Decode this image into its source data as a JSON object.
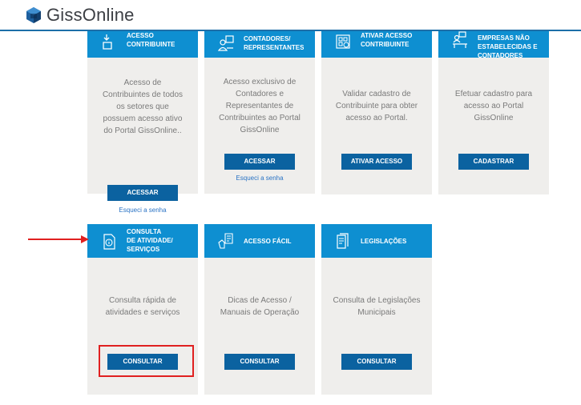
{
  "app": {
    "logo_text": "GissOnline"
  },
  "colors": {
    "header_blue": "#0e8fd1",
    "button_blue": "#0b62a0",
    "card_bg": "#efeeec",
    "annotation_red": "#e02020"
  },
  "cards": [
    {
      "title": "Acesso\nContribuinte",
      "icon": "door-enter-icon",
      "description": "Acesso de\nContribuintes de todos\nos setores que\npossuem acesso ativo\ndo Portal GissOnline..",
      "button": "ACESSAR",
      "link": "Esqueci a senha"
    },
    {
      "title": "Contadores/\nRepresentantes",
      "icon": "accountant-icon",
      "description": "Acesso exclusivo de\nContadores e\nRepresentantes de\nContribuintes ao Portal\nGissOnline",
      "button": "ACESSAR",
      "link": "Esqueci a senha"
    },
    {
      "title": "Ativar Acesso\nContribuinte",
      "icon": "qr-activate-icon",
      "description": "Validar cadastro de\nContribuinte para obter\nacesso ao Portal.",
      "button": "ATIVAR ACESSO"
    },
    {
      "title": "Empresas não\nestabelecidas e\ncontadores",
      "icon": "company-desk-icon",
      "description": "Efetuar cadastro para\nacesso ao Portal\nGissOnline",
      "button": "CADASTRAR"
    },
    {
      "title": "Consulta\nde atividade/\nserviços",
      "icon": "document-info-icon",
      "description": "Consulta rápida de\natividades e serviços",
      "button": "CONSULTAR"
    },
    {
      "title": "Acesso Fácil",
      "icon": "hand-document-icon",
      "description": "Dicas de Acesso /\nManuais de Operação",
      "button": "CONSULTAR"
    },
    {
      "title": "Legislações",
      "icon": "legislation-book-icon",
      "description": "Consulta de Legislações\nMunicipais",
      "button": "CONSULTAR"
    }
  ]
}
